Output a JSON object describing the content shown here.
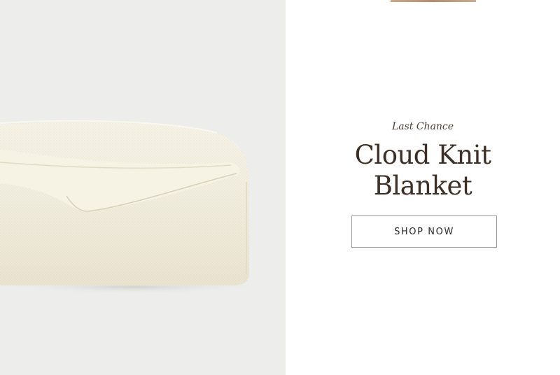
{
  "hero": {
    "image_subject": "folded cream knit blanket",
    "colors": {
      "photo_background": "#ededeb",
      "blanket": "#f4f0e0",
      "title": "#3e2f26",
      "button_border": "#9b9b9b"
    }
  },
  "promo": {
    "eyebrow": "Last Chance",
    "title_line_1": "Cloud Knit",
    "title_line_2": "Blanket",
    "cta_label": "SHOP NOW"
  }
}
